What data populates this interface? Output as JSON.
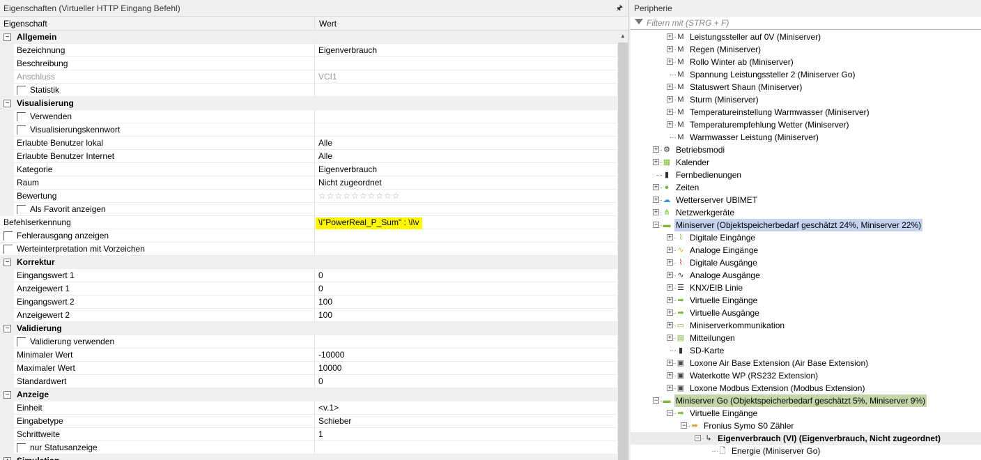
{
  "left": {
    "title": "Eigenschaften (Virtueller HTTP Eingang Befehl)",
    "pin": "🖈",
    "col_name": "Eigenschaft",
    "col_value": "Wert",
    "rows": [
      {
        "t": "sec",
        "name": "Allgemein"
      },
      {
        "t": "prop",
        "name": "Bezeichnung",
        "val": "Eigenverbrauch"
      },
      {
        "t": "prop",
        "name": "Beschreibung",
        "val": ""
      },
      {
        "t": "prop",
        "name": "Anschluss",
        "val": "VCI1",
        "dis": true
      },
      {
        "t": "chk",
        "name": "Statistik"
      },
      {
        "t": "sec",
        "name": "Visualisierung"
      },
      {
        "t": "chk",
        "name": "Verwenden"
      },
      {
        "t": "chk",
        "name": "Visualisierungskennwort"
      },
      {
        "t": "prop",
        "name": "Erlaubte Benutzer lokal",
        "val": "Alle"
      },
      {
        "t": "prop",
        "name": "Erlaubte Benutzer Internet",
        "val": "Alle"
      },
      {
        "t": "prop",
        "name": "Kategorie",
        "val": "Eigenverbrauch"
      },
      {
        "t": "prop",
        "name": "Raum",
        "val": "Nicht zugeordnet"
      },
      {
        "t": "prop",
        "name": "Bewertung",
        "val": "☆☆☆☆☆☆☆☆☆☆",
        "stars": true
      },
      {
        "t": "chk",
        "name": "Als Favorit anzeigen"
      },
      {
        "t": "prop",
        "name": "Befehlserkennung",
        "val": "\\i\"PowerReal_P_Sum\" : \\i\\v",
        "top": true,
        "hl": true
      },
      {
        "t": "chk",
        "name": "Fehlerausgang anzeigen",
        "top": true
      },
      {
        "t": "chk",
        "name": "Werteinterpretation mit Vorzeichen",
        "top": true
      },
      {
        "t": "sec",
        "name": "Korrektur"
      },
      {
        "t": "prop",
        "name": "Eingangswert 1",
        "val": "0"
      },
      {
        "t": "prop",
        "name": "Anzeigewert 1",
        "val": "0"
      },
      {
        "t": "prop",
        "name": "Eingangswert 2",
        "val": "100"
      },
      {
        "t": "prop",
        "name": "Anzeigewert 2",
        "val": "100"
      },
      {
        "t": "sec",
        "name": "Validierung"
      },
      {
        "t": "chk",
        "name": "Validierung verwenden"
      },
      {
        "t": "prop",
        "name": "Minimaler Wert",
        "val": "-10000"
      },
      {
        "t": "prop",
        "name": "Maximaler Wert",
        "val": "10000"
      },
      {
        "t": "prop",
        "name": "Standardwert",
        "val": "0"
      },
      {
        "t": "sec",
        "name": "Anzeige"
      },
      {
        "t": "prop",
        "name": "Einheit",
        "val": "<v.1>"
      },
      {
        "t": "prop",
        "name": "Eingabetype",
        "val": "Schieber"
      },
      {
        "t": "prop",
        "name": "Schrittweite",
        "val": "1"
      },
      {
        "t": "chk",
        "name": "nur Statusanzeige"
      },
      {
        "t": "sec",
        "name": "Simulation",
        "collapsed": true
      }
    ]
  },
  "right": {
    "title": "Peripherie",
    "filter_placeholder": "Filtern mit (STRG + F)",
    "tree": [
      {
        "l": 2,
        "x": "+",
        "i": "M",
        "c": "#333",
        "label": "Leistungssteller auf 0V (Miniserver)"
      },
      {
        "l": 2,
        "x": "+",
        "i": "M",
        "c": "#333",
        "label": "Regen (Miniserver)"
      },
      {
        "l": 2,
        "x": "+",
        "i": "M",
        "c": "#333",
        "label": "Rollo Winter ab (Miniserver)"
      },
      {
        "l": 2,
        "x": "",
        "i": "M",
        "c": "#333",
        "label": "Spannung Leistungssteller 2 (Miniserver Go)"
      },
      {
        "l": 2,
        "x": "+",
        "i": "M",
        "c": "#333",
        "label": "Statuswert Shaun (Miniserver)"
      },
      {
        "l": 2,
        "x": "+",
        "i": "M",
        "c": "#333",
        "label": "Sturm (Miniserver)"
      },
      {
        "l": 2,
        "x": "+",
        "i": "M",
        "c": "#333",
        "label": "Temperatureinstellung Warmwasser (Miniserver)"
      },
      {
        "l": 2,
        "x": "+",
        "i": "M",
        "c": "#333",
        "label": "Temperaturempfehlung Wetter (Miniserver)"
      },
      {
        "l": 2,
        "x": "",
        "i": "M",
        "c": "#333",
        "label": "Warmwasser Leistung (Miniserver)"
      },
      {
        "l": 1,
        "x": "+",
        "i": "⚙",
        "c": "#333",
        "label": "Betriebsmodi"
      },
      {
        "l": 1,
        "x": "+",
        "i": "▦",
        "c": "#7cb82f",
        "label": "Kalender"
      },
      {
        "l": 1,
        "x": "",
        "i": "▮",
        "c": "#333",
        "label": "Fernbedienungen"
      },
      {
        "l": 1,
        "x": "+",
        "i": "●",
        "c": "#7cb82f",
        "label": "Zeiten"
      },
      {
        "l": 1,
        "x": "+",
        "i": "☁",
        "c": "#3a9ad9",
        "label": "Wetterserver UBIMET"
      },
      {
        "l": 1,
        "x": "+",
        "i": "⋔",
        "c": "#7cb82f",
        "label": "Netzwerkgeräte"
      },
      {
        "l": 1,
        "x": "-",
        "i": "▬",
        "c": "#7cb82f",
        "label": "Miniserver (Objektspeicherbedarf geschätzt 24%, Miniserver 22%)",
        "bg": "#c5d3ee"
      },
      {
        "l": 2,
        "x": "+",
        "i": "⌇",
        "c": "#7cb82f",
        "label": "Digitale Eingänge"
      },
      {
        "l": 2,
        "x": "+",
        "i": "∿",
        "c": "#e0a020",
        "label": "Analoge Eingänge"
      },
      {
        "l": 2,
        "x": "+",
        "i": "⌇",
        "c": "#d33",
        "label": "Digitale Ausgänge"
      },
      {
        "l": 2,
        "x": "+",
        "i": "∿",
        "c": "#333",
        "label": "Analoge Ausgänge"
      },
      {
        "l": 2,
        "x": "+",
        "i": "☰",
        "c": "#333",
        "label": "KNX/EIB Linie"
      },
      {
        "l": 2,
        "x": "+",
        "i": "➡",
        "c": "#7cb82f",
        "label": "Virtuelle Eingänge"
      },
      {
        "l": 2,
        "x": "+",
        "i": "➡",
        "c": "#7cb82f",
        "label": "Virtuelle Ausgänge"
      },
      {
        "l": 2,
        "x": "+",
        "i": "▭",
        "c": "#7cb82f",
        "label": "Miniserverkommunikation"
      },
      {
        "l": 2,
        "x": "+",
        "i": "▤",
        "c": "#7cb82f",
        "label": "Mitteilungen"
      },
      {
        "l": 2,
        "x": "",
        "i": "▮",
        "c": "#333",
        "label": "SD-Karte"
      },
      {
        "l": 2,
        "x": "+",
        "i": "▣",
        "c": "#444",
        "label": "Loxone Air Base Extension (Air Base Extension)"
      },
      {
        "l": 2,
        "x": "+",
        "i": "▣",
        "c": "#444",
        "label": "Waterkotte WP (RS232 Extension)"
      },
      {
        "l": 2,
        "x": "+",
        "i": "▣",
        "c": "#444",
        "label": "Loxone Modbus Extension (Modbus Extension)"
      },
      {
        "l": 1,
        "x": "-",
        "i": "▬",
        "c": "#7cb82f",
        "label": "Miniserver Go (Objektspeicherbedarf geschätzt 5%, Miniserver 9%)",
        "bg": "#c4d6a8"
      },
      {
        "l": 2,
        "x": "-",
        "i": "➡",
        "c": "#7cb82f",
        "label": "Virtuelle Eingänge"
      },
      {
        "l": 3,
        "x": "-",
        "i": "➡",
        "c": "#e0a020",
        "label": "Fronius Symo S0 Zähler"
      },
      {
        "l": 4,
        "x": "-",
        "i": "↳",
        "c": "#333",
        "label": "Eigenverbrauch (VI) (Eigenverbrauch, Nicht zugeordnet)",
        "bold": true,
        "rowbg": "#ececec"
      },
      {
        "l": 5,
        "x": "",
        "i": "🗋",
        "c": "#333",
        "label": "Energie (Miniserver Go)"
      }
    ]
  }
}
